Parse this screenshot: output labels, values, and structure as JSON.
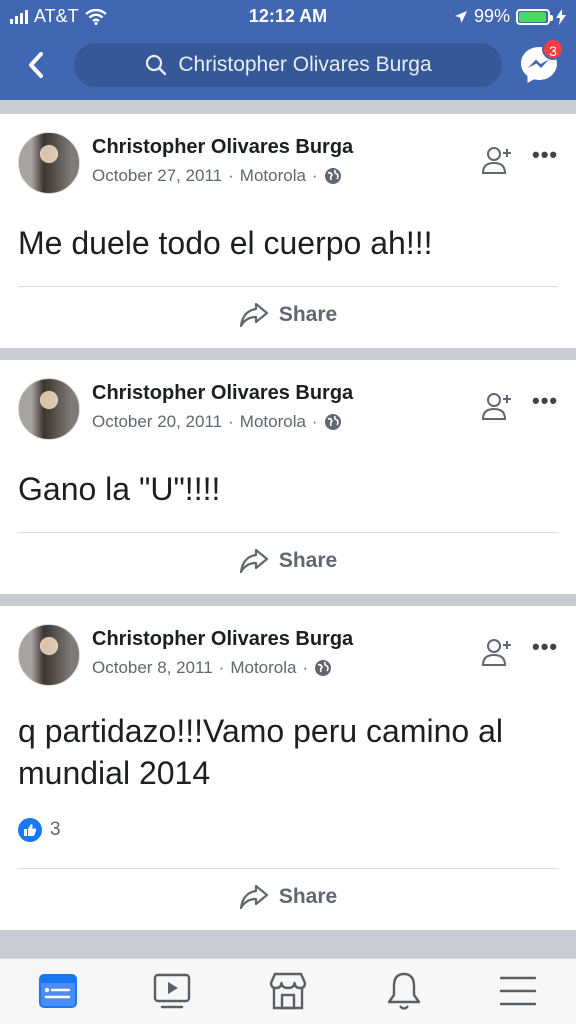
{
  "status_bar": {
    "carrier": "AT&T",
    "time": "12:12 AM",
    "battery": "99%"
  },
  "nav": {
    "search_query": "Christopher Olivares Burga",
    "messenger_badge": "3"
  },
  "posts": [
    {
      "author": "Christopher Olivares Burga",
      "date": "October 27, 2011",
      "via": "Motorola",
      "text": "Me duele todo el cuerpo ah!!!",
      "share": "Share"
    },
    {
      "author": "Christopher Olivares Burga",
      "date": "October 20, 2011",
      "via": "Motorola",
      "text": "Gano la \"U\"!!!!",
      "share": "Share"
    },
    {
      "author": "Christopher Olivares Burga",
      "date": "October 8, 2011",
      "via": "Motorola",
      "text_line1": "q partidazo!!!Vamo peru camino al",
      "text_line2": "mundial 2014",
      "likes": "3",
      "share": "Share"
    }
  ],
  "colors": {
    "brand": "#4267b2",
    "accent": "#1877f2",
    "badge": "#fa3e3e"
  },
  "icons": [
    "back-chevron-icon",
    "search-icon",
    "messenger-icon",
    "add-friend-icon",
    "more-icon",
    "globe-icon",
    "share-icon",
    "like-icon",
    "news-feed-icon",
    "watch-icon",
    "marketplace-icon",
    "notifications-icon",
    "menu-icon"
  ]
}
